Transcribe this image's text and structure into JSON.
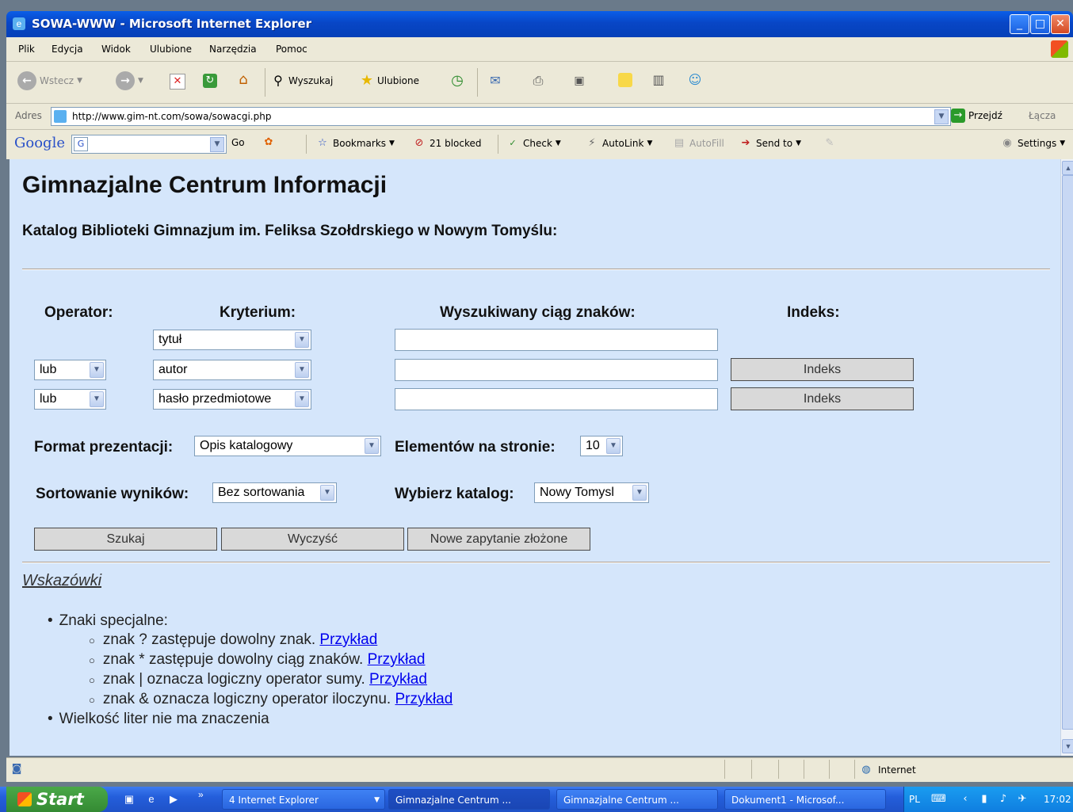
{
  "window": {
    "title": "SOWA-WWW - Microsoft Internet Explorer"
  },
  "menu": [
    "Plik",
    "Edycja",
    "Widok",
    "Ulubione",
    "Narzędzia",
    "Pomoc"
  ],
  "toolbar": {
    "back": "Wstecz",
    "search": "Wyszukaj",
    "favorites": "Ulubione"
  },
  "address": {
    "label": "Adres",
    "url": "http://www.gim-nt.com/sowa/sowacgi.php",
    "go": "Przejdź",
    "links": "Łącza"
  },
  "google": {
    "logo": "Google",
    "go": "Go",
    "bookmarks": "Bookmarks",
    "blocked": "21 blocked",
    "check": "Check",
    "autolink": "AutoLink",
    "autofill": "AutoFill",
    "sendto": "Send to",
    "settings": "Settings"
  },
  "page": {
    "title": "Gimnazjalne Centrum Informacji",
    "subtitle": "Katalog Biblioteki Gimnazjum im. Feliksa Szołdrskiego w Nowym Tomyślu:",
    "headers": {
      "operator": "Operator:",
      "criterion": "Kryterium:",
      "query": "Wyszukiwany ciąg znaków:",
      "index": "Indeks:"
    },
    "rows": [
      {
        "operator": "",
        "criterion": "tytuł",
        "value": "",
        "index": ""
      },
      {
        "operator": "lub",
        "criterion": "autor",
        "value": "",
        "index": "Indeks"
      },
      {
        "operator": "lub",
        "criterion": "hasło przedmiotowe",
        "value": "",
        "index": "Indeks"
      }
    ],
    "format_label": "Format prezentacji:",
    "format_value": "Opis katalogowy",
    "per_page_label": "Elementów na stronie:",
    "per_page_value": "10",
    "sort_label": "Sortowanie wyników:",
    "sort_value": "Bez sortowania",
    "catalog_label": "Wybierz katalog:",
    "catalog_value": "Nowy Tomysl",
    "buttons": {
      "search": "Szukaj",
      "clear": "Wyczyść",
      "new_query": "Nowe zapytanie złożone"
    },
    "tips_title": "Wskazówki",
    "tips": {
      "special": "Znaki specjalne:",
      "items": [
        {
          "text": "znak ? zastępuje dowolny znak.",
          "link": "Przykład"
        },
        {
          "text": "znak * zastępuje dowolny ciąg znaków.",
          "link": "Przykład"
        },
        {
          "text": "znak | oznacza logiczny operator sumy.",
          "link": "Przykład"
        },
        {
          "text": "znak & oznacza logiczny operator iloczynu.",
          "link": "Przykład"
        }
      ],
      "case": "Wielkość liter nie ma znaczenia"
    }
  },
  "status": {
    "zone": "Internet"
  },
  "taskbar": {
    "start": "Start",
    "tasks": [
      "4 Internet Explorer",
      "Gimnazjalne Centrum ...",
      "Gimnazjalne Centrum ...",
      "Dokument1 - Microsof..."
    ],
    "lang": "PL",
    "clock": "17:02"
  }
}
